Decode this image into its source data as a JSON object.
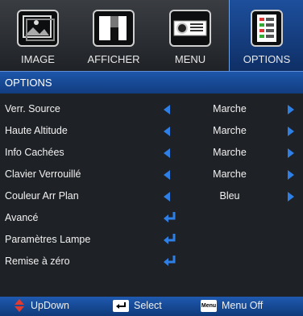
{
  "tabs": [
    {
      "label": "IMAGE",
      "icon": "image-icon"
    },
    {
      "label": "AFFICHER",
      "icon": "display-icon"
    },
    {
      "label": "MENU",
      "icon": "projector-icon"
    },
    {
      "label": "OPTIONS",
      "icon": "options-icon",
      "active": true
    }
  ],
  "section_title": "OPTIONS",
  "rows": [
    {
      "label": "Verr. Source",
      "value": "Marche"
    },
    {
      "label": "Haute Altitude",
      "value": "Marche"
    },
    {
      "label": "Info Cachées",
      "value": "Marche"
    },
    {
      "label": "Clavier Verrouillé",
      "value": "Marche"
    },
    {
      "label": "Couleur Arr Plan",
      "value": "Bleu"
    },
    {
      "label": "Avancé"
    },
    {
      "label": "Paramètres Lampe"
    },
    {
      "label": "Remise à zéro"
    }
  ],
  "footer": {
    "updown_label": "UpDown",
    "select_label": "Select",
    "menu_key_label": "Menu",
    "menu_label": "Menu Off"
  },
  "colors": {
    "accent": "#2e7fe6",
    "header": "#1d56aa",
    "enter_icon": "#2e7fe6",
    "updown_icon": "#e23b2e"
  }
}
